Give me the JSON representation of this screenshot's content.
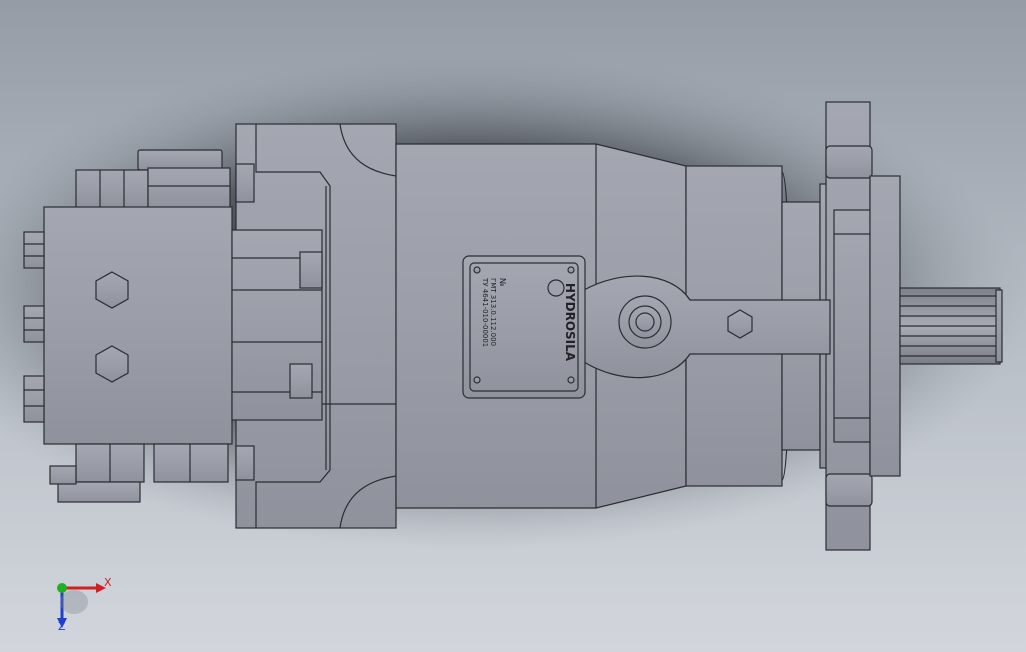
{
  "window": {
    "background_top": "#9aa1aa",
    "background_bottom": "#ced3da",
    "shadow_color": "#2a2e33"
  },
  "model": {
    "body_color": "#9a9ca7",
    "edge_color": "#2b2d33",
    "nameplate": {
      "brand": "HYDROSILA",
      "lines": [
        "№",
        "ГМТ 313.0.112.000",
        "ТУ 4641-010-00001"
      ]
    }
  },
  "triad": {
    "x_label": "X",
    "z_label": "Z",
    "x_color": "#d02020",
    "y_color": "#22b022",
    "z_color": "#1c3fd0"
  }
}
